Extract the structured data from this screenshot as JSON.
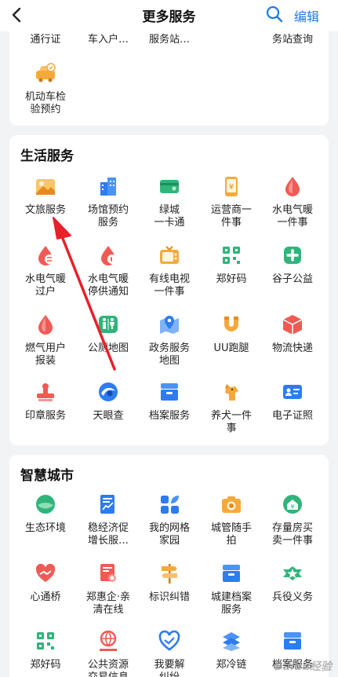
{
  "header": {
    "title": "更多服务",
    "edit_label": "编辑"
  },
  "transport": {
    "partial": [
      "通行证",
      "车入户…",
      "服务站…",
      "务站查询"
    ],
    "items": [
      {
        "label": "机动车检\n验预约",
        "icon": "car-inspection-icon"
      }
    ]
  },
  "life": {
    "title": "生活服务",
    "items": [
      {
        "label": "文旅服务",
        "icon": "landscape-icon"
      },
      {
        "label": "场馆预约\n服务",
        "icon": "venue-building-icon"
      },
      {
        "label": "绿城\n一卡通",
        "icon": "card-wallet-icon"
      },
      {
        "label": "运营商一\n件事",
        "icon": "phone-yen-icon"
      },
      {
        "label": "水电气暖\n一件事",
        "icon": "water-drop-icon"
      },
      {
        "label": "水电气暖\n过户",
        "icon": "drop-transfer-icon"
      },
      {
        "label": "水电气暖\n停供通知",
        "icon": "drop-notice-icon"
      },
      {
        "label": "有线电视\n一件事",
        "icon": "tv-icon"
      },
      {
        "label": "郑好码",
        "icon": "qr-code-icon"
      },
      {
        "label": "谷子公益",
        "icon": "charity-plus-icon"
      },
      {
        "label": "燃气用户\n报装",
        "icon": "gas-drop-icon"
      },
      {
        "label": "公厕地图",
        "icon": "toilet-icon"
      },
      {
        "label": "政务服务\n地图",
        "icon": "map-pin-icon"
      },
      {
        "label": "UU跑腿",
        "icon": "magnet-icon"
      },
      {
        "label": "物流快递",
        "icon": "package-icon"
      },
      {
        "label": "印章服务",
        "icon": "stamp-icon"
      },
      {
        "label": "天眼查",
        "icon": "eye-swirl-icon"
      },
      {
        "label": "档案服务",
        "icon": "archive-box-icon"
      },
      {
        "label": "养犬一件\n事",
        "icon": "dog-icon"
      },
      {
        "label": "电子证照",
        "icon": "id-card-icon"
      }
    ]
  },
  "city": {
    "title": "智慧城市",
    "items": [
      {
        "label": "生态环境",
        "icon": "leaf-ball-icon"
      },
      {
        "label": "稳经济促\n增长服…",
        "icon": "document-chart-icon"
      },
      {
        "label": "我的网格\n家园",
        "icon": "grid-leaf-icon"
      },
      {
        "label": "城管随手\n拍",
        "icon": "camera-icon"
      },
      {
        "label": "存量房买\n卖一件事",
        "icon": "house-yen-icon"
      },
      {
        "label": "心通桥",
        "icon": "heart-bridge-icon"
      },
      {
        "label": "郑惠企·亲\n清在线",
        "icon": "certificate-icon"
      },
      {
        "label": "标识纠错",
        "icon": "signpost-icon"
      },
      {
        "label": "城建档案\n服务",
        "icon": "archive-tray-icon"
      },
      {
        "label": "兵役义务",
        "icon": "military-star-icon"
      },
      {
        "label": "郑好码",
        "icon": "qr-code-icon"
      },
      {
        "label": "公共资源\n交易信息",
        "icon": "globe-hand-icon"
      },
      {
        "label": "我要解\n纠纷",
        "icon": "heart-hands-icon"
      },
      {
        "label": "郑冷链",
        "icon": "cold-chain-icon"
      },
      {
        "label": "档案服务",
        "icon": "archive-box-icon"
      }
    ]
  },
  "watermark": "Baidu经验",
  "colors": {
    "accent": "#1f7ce6",
    "annotation_arrow": "#e8202a"
  }
}
